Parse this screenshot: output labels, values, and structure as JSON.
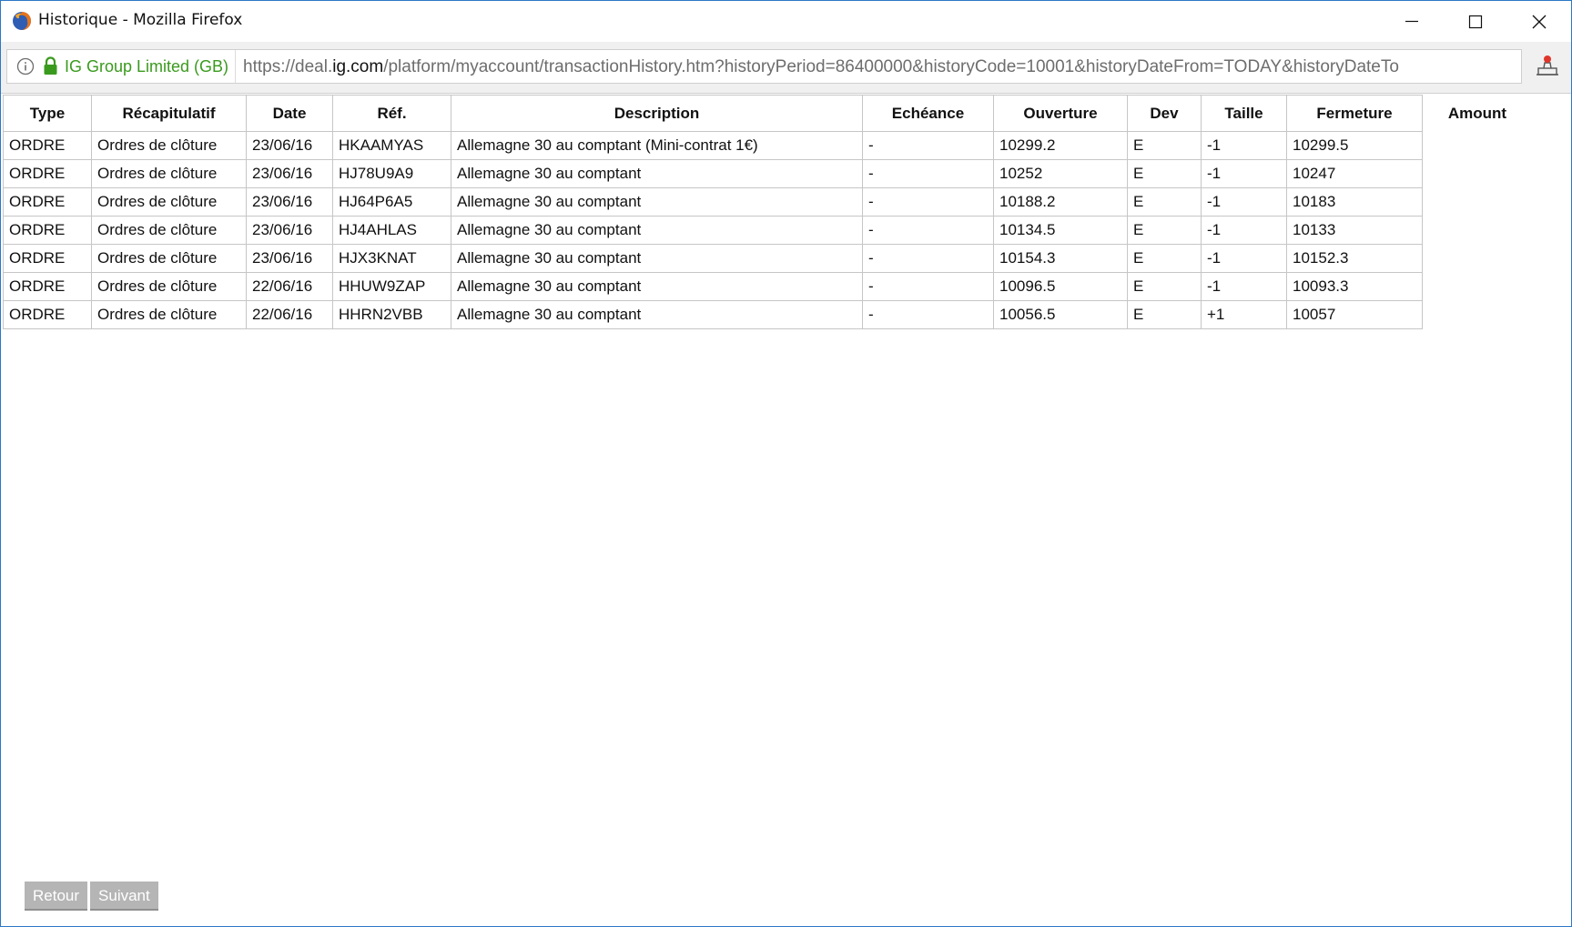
{
  "window": {
    "title": "Historique - Mozilla Firefox"
  },
  "urlbar": {
    "identity": "IG Group Limited (GB)",
    "url_prefix": "https://deal.",
    "url_domain": "ig.com",
    "url_path": "/platform/myaccount/transactionHistory.htm?historyPeriod=86400000&historyCode=10001&historyDateFrom=TODAY&historyDateTo"
  },
  "table": {
    "headers": [
      "Type",
      "Récapitulatif",
      "Date",
      "Réf.",
      "Description",
      "Echéance",
      "Ouverture",
      "Dev",
      "Taille",
      "Fermeture",
      "Amount"
    ],
    "rows": [
      [
        "ORDRE",
        "Ordres de clôture",
        "23/06/16",
        "HKAAMYAS",
        "Allemagne 30 au comptant (Mini-contrat 1€)",
        "-",
        "10299.2",
        "E",
        "-1",
        "10299.5",
        ""
      ],
      [
        "ORDRE",
        "Ordres de clôture",
        "23/06/16",
        "HJ78U9A9",
        "Allemagne 30 au comptant",
        "-",
        "10252",
        "E",
        "-1",
        "10247",
        ""
      ],
      [
        "ORDRE",
        "Ordres de clôture",
        "23/06/16",
        "HJ64P6A5",
        "Allemagne 30 au comptant",
        "-",
        "10188.2",
        "E",
        "-1",
        "10183",
        ""
      ],
      [
        "ORDRE",
        "Ordres de clôture",
        "23/06/16",
        "HJ4AHLAS",
        "Allemagne 30 au comptant",
        "-",
        "10134.5",
        "E",
        "-1",
        "10133",
        ""
      ],
      [
        "ORDRE",
        "Ordres de clôture",
        "23/06/16",
        "HJX3KNAT",
        "Allemagne 30 au comptant",
        "-",
        "10154.3",
        "E",
        "-1",
        "10152.3",
        ""
      ],
      [
        "ORDRE",
        "Ordres de clôture",
        "22/06/16",
        "HHUW9ZAP",
        "Allemagne 30 au comptant",
        "-",
        "10096.5",
        "E",
        "-1",
        "10093.3",
        ""
      ],
      [
        "ORDRE",
        "Ordres de clôture",
        "22/06/16",
        "HHRN2VBB",
        "Allemagne 30 au comptant",
        "-",
        "10056.5",
        "E",
        "+1",
        "10057",
        ""
      ]
    ]
  },
  "pager": {
    "back_label": "Retour",
    "next_label": "Suivant"
  },
  "icons": {
    "app": "firefox-icon",
    "info": "info-icon",
    "lock": "lock-icon",
    "reader": "reader-view-icon"
  },
  "colors": {
    "window_border": "#2b78c6",
    "identity_green": "#3a9a1e",
    "button_gray": "#b5b5b5"
  }
}
